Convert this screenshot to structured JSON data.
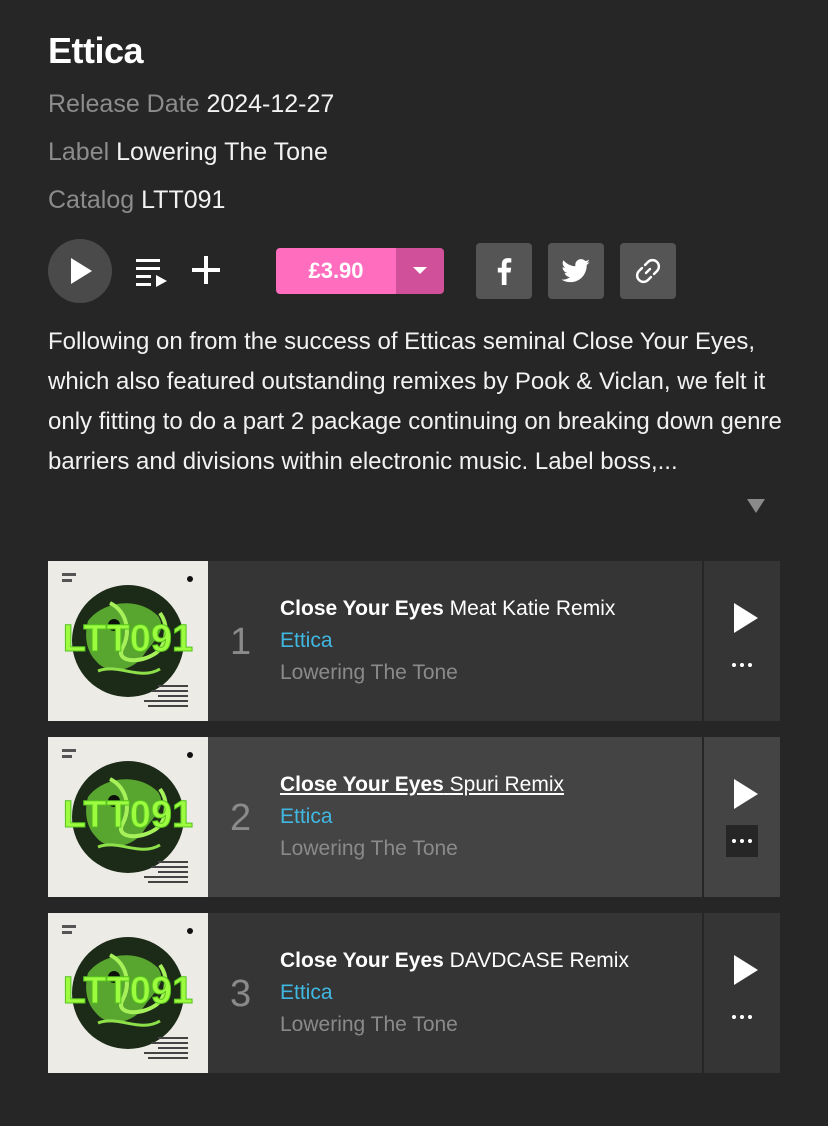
{
  "release": {
    "title": "Ettica",
    "release_date_key": "Release Date",
    "release_date": "2024-12-27",
    "label_key": "Label",
    "label": "Lowering The Tone",
    "catalog_key": "Catalog",
    "catalog": "LTT091"
  },
  "actions": {
    "price": "£3.90"
  },
  "colors": {
    "accent_pink": "#ff6dbf",
    "artist_link": "#40b7e0"
  },
  "description": "Following on from the success of Etticas seminal Close Your Eyes, which also featured outstanding remixes by Pook & Viclan, we felt it only fitting to do a part 2 package continuing on breaking down genre barriers and divisions within electronic music. Label boss,...",
  "tracks": [
    {
      "number": "1",
      "name": "Close Your Eyes",
      "mix": "Meat Katie Remix",
      "artist": "Ettica",
      "label": "Lowering The Tone"
    },
    {
      "number": "2",
      "name": "Close Your Eyes",
      "mix": "Spuri Remix",
      "artist": "Ettica",
      "label": "Lowering The Tone"
    },
    {
      "number": "3",
      "name": "Close Your Eyes",
      "mix": "DAVDCASE Remix",
      "artist": "Ettica",
      "label": "Lowering The Tone"
    }
  ],
  "artwork": {
    "catalog_text": "LTT091"
  }
}
